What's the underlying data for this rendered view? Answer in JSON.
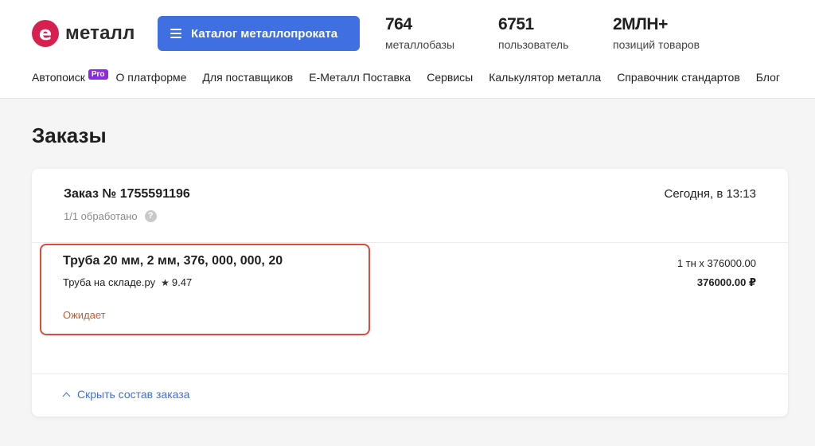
{
  "header": {
    "logo": {
      "mark": "е",
      "text": "металл"
    },
    "catalog_button": "Каталог металлопроката",
    "stats": [
      {
        "value": "764",
        "label": "металлобазы"
      },
      {
        "value": "6751",
        "label": "пользователь"
      },
      {
        "value": "2МЛН+",
        "label": "позиций товаров"
      }
    ],
    "nav": {
      "autosearch": "Автопоиск",
      "pro_badge": "Pro",
      "items": [
        "О платформе",
        "Для поставщиков",
        "Е-Металл Поставка",
        "Сервисы",
        "Калькулятор металла",
        "Справочник стандартов",
        "Блог"
      ]
    }
  },
  "page": {
    "title": "Заказы"
  },
  "order": {
    "title": "Заказ № 1755591196",
    "date": "Сегодня, в 13:13",
    "status": "1/1 обработано",
    "help_icon": "?",
    "item": {
      "name": "Труба 20 мм, 2 мм, 376, 000, 000, 20",
      "seller": "Труба на складе.ру",
      "rating_icon": "★",
      "rating": "9.47",
      "state": "Ожидает",
      "quantity": "1 тн x 376000.00",
      "total": "376000.00 ₽"
    },
    "toggle_label": "Скрыть состав заказа"
  },
  "colors": {
    "brand": "#d62050",
    "accent": "#3f6fe0",
    "pending": "#d4572a",
    "highlight_border": "#e04a3a",
    "pro_badge": "#8a2be2"
  }
}
